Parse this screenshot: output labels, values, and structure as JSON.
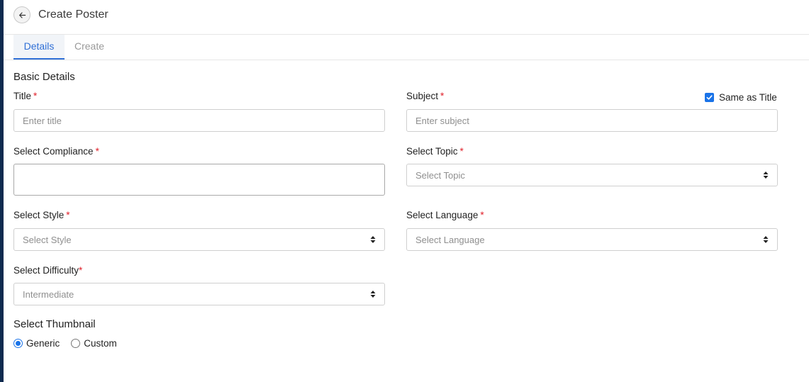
{
  "header": {
    "title": "Create Poster"
  },
  "tabs": [
    {
      "label": "Details",
      "active": true
    },
    {
      "label": "Create",
      "active": false
    }
  ],
  "form": {
    "section_basic": "Basic Details",
    "title": {
      "label": "Title",
      "placeholder": "Enter title",
      "value": ""
    },
    "subject": {
      "label": "Subject",
      "placeholder": "Enter subject",
      "value": ""
    },
    "same_as_title": {
      "label": "Same as Title",
      "checked": true
    },
    "compliance": {
      "label": "Select Compliance",
      "value": ""
    },
    "topic": {
      "label": "Select Topic",
      "value": "Select Topic"
    },
    "style": {
      "label": "Select Style",
      "value": "Select Style"
    },
    "language": {
      "label": "Select Language",
      "value": "Select Language"
    },
    "difficulty": {
      "label": "Select Difficulty",
      "value": "Intermediate"
    },
    "required_mark": "*",
    "section_thumbnail": "Select Thumbnail",
    "thumbnail_options": [
      {
        "label": "Generic",
        "selected": true
      },
      {
        "label": "Custom",
        "selected": false
      }
    ]
  },
  "colors": {
    "accent": "#1a73e8",
    "tab_active": "#2f6fd6",
    "required": "#e0202a",
    "sidebar": "#0e2a4f"
  }
}
